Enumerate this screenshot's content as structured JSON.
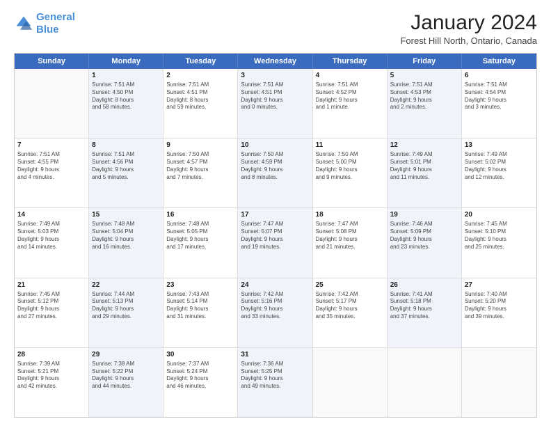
{
  "logo": {
    "line1": "General",
    "line2": "Blue"
  },
  "title": "January 2024",
  "subtitle": "Forest Hill North, Ontario, Canada",
  "header_days": [
    "Sunday",
    "Monday",
    "Tuesday",
    "Wednesday",
    "Thursday",
    "Friday",
    "Saturday"
  ],
  "weeks": [
    [
      {
        "day": "",
        "info": [],
        "shaded": false,
        "empty": true
      },
      {
        "day": "1",
        "info": [
          "Sunrise: 7:51 AM",
          "Sunset: 4:50 PM",
          "Daylight: 8 hours",
          "and 58 minutes."
        ],
        "shaded": true
      },
      {
        "day": "2",
        "info": [
          "Sunrise: 7:51 AM",
          "Sunset: 4:51 PM",
          "Daylight: 8 hours",
          "and 59 minutes."
        ],
        "shaded": false
      },
      {
        "day": "3",
        "info": [
          "Sunrise: 7:51 AM",
          "Sunset: 4:51 PM",
          "Daylight: 9 hours",
          "and 0 minutes."
        ],
        "shaded": true
      },
      {
        "day": "4",
        "info": [
          "Sunrise: 7:51 AM",
          "Sunset: 4:52 PM",
          "Daylight: 9 hours",
          "and 1 minute."
        ],
        "shaded": false
      },
      {
        "day": "5",
        "info": [
          "Sunrise: 7:51 AM",
          "Sunset: 4:53 PM",
          "Daylight: 9 hours",
          "and 2 minutes."
        ],
        "shaded": true
      },
      {
        "day": "6",
        "info": [
          "Sunrise: 7:51 AM",
          "Sunset: 4:54 PM",
          "Daylight: 9 hours",
          "and 3 minutes."
        ],
        "shaded": false
      }
    ],
    [
      {
        "day": "7",
        "info": [
          "Sunrise: 7:51 AM",
          "Sunset: 4:55 PM",
          "Daylight: 9 hours",
          "and 4 minutes."
        ],
        "shaded": false,
        "empty": false
      },
      {
        "day": "8",
        "info": [
          "Sunrise: 7:51 AM",
          "Sunset: 4:56 PM",
          "Daylight: 9 hours",
          "and 5 minutes."
        ],
        "shaded": true
      },
      {
        "day": "9",
        "info": [
          "Sunrise: 7:50 AM",
          "Sunset: 4:57 PM",
          "Daylight: 9 hours",
          "and 7 minutes."
        ],
        "shaded": false
      },
      {
        "day": "10",
        "info": [
          "Sunrise: 7:50 AM",
          "Sunset: 4:59 PM",
          "Daylight: 9 hours",
          "and 8 minutes."
        ],
        "shaded": true
      },
      {
        "day": "11",
        "info": [
          "Sunrise: 7:50 AM",
          "Sunset: 5:00 PM",
          "Daylight: 9 hours",
          "and 9 minutes."
        ],
        "shaded": false
      },
      {
        "day": "12",
        "info": [
          "Sunrise: 7:49 AM",
          "Sunset: 5:01 PM",
          "Daylight: 9 hours",
          "and 11 minutes."
        ],
        "shaded": true
      },
      {
        "day": "13",
        "info": [
          "Sunrise: 7:49 AM",
          "Sunset: 5:02 PM",
          "Daylight: 9 hours",
          "and 12 minutes."
        ],
        "shaded": false
      }
    ],
    [
      {
        "day": "14",
        "info": [
          "Sunrise: 7:49 AM",
          "Sunset: 5:03 PM",
          "Daylight: 9 hours",
          "and 14 minutes."
        ],
        "shaded": false,
        "empty": false
      },
      {
        "day": "15",
        "info": [
          "Sunrise: 7:48 AM",
          "Sunset: 5:04 PM",
          "Daylight: 9 hours",
          "and 16 minutes."
        ],
        "shaded": true
      },
      {
        "day": "16",
        "info": [
          "Sunrise: 7:48 AM",
          "Sunset: 5:05 PM",
          "Daylight: 9 hours",
          "and 17 minutes."
        ],
        "shaded": false
      },
      {
        "day": "17",
        "info": [
          "Sunrise: 7:47 AM",
          "Sunset: 5:07 PM",
          "Daylight: 9 hours",
          "and 19 minutes."
        ],
        "shaded": true
      },
      {
        "day": "18",
        "info": [
          "Sunrise: 7:47 AM",
          "Sunset: 5:08 PM",
          "Daylight: 9 hours",
          "and 21 minutes."
        ],
        "shaded": false
      },
      {
        "day": "19",
        "info": [
          "Sunrise: 7:46 AM",
          "Sunset: 5:09 PM",
          "Daylight: 9 hours",
          "and 23 minutes."
        ],
        "shaded": true
      },
      {
        "day": "20",
        "info": [
          "Sunrise: 7:45 AM",
          "Sunset: 5:10 PM",
          "Daylight: 9 hours",
          "and 25 minutes."
        ],
        "shaded": false
      }
    ],
    [
      {
        "day": "21",
        "info": [
          "Sunrise: 7:45 AM",
          "Sunset: 5:12 PM",
          "Daylight: 9 hours",
          "and 27 minutes."
        ],
        "shaded": false,
        "empty": false
      },
      {
        "day": "22",
        "info": [
          "Sunrise: 7:44 AM",
          "Sunset: 5:13 PM",
          "Daylight: 9 hours",
          "and 29 minutes."
        ],
        "shaded": true
      },
      {
        "day": "23",
        "info": [
          "Sunrise: 7:43 AM",
          "Sunset: 5:14 PM",
          "Daylight: 9 hours",
          "and 31 minutes."
        ],
        "shaded": false
      },
      {
        "day": "24",
        "info": [
          "Sunrise: 7:42 AM",
          "Sunset: 5:16 PM",
          "Daylight: 9 hours",
          "and 33 minutes."
        ],
        "shaded": true
      },
      {
        "day": "25",
        "info": [
          "Sunrise: 7:42 AM",
          "Sunset: 5:17 PM",
          "Daylight: 9 hours",
          "and 35 minutes."
        ],
        "shaded": false
      },
      {
        "day": "26",
        "info": [
          "Sunrise: 7:41 AM",
          "Sunset: 5:18 PM",
          "Daylight: 9 hours",
          "and 37 minutes."
        ],
        "shaded": true
      },
      {
        "day": "27",
        "info": [
          "Sunrise: 7:40 AM",
          "Sunset: 5:20 PM",
          "Daylight: 9 hours",
          "and 39 minutes."
        ],
        "shaded": false
      }
    ],
    [
      {
        "day": "28",
        "info": [
          "Sunrise: 7:39 AM",
          "Sunset: 5:21 PM",
          "Daylight: 9 hours",
          "and 42 minutes."
        ],
        "shaded": false,
        "empty": false
      },
      {
        "day": "29",
        "info": [
          "Sunrise: 7:38 AM",
          "Sunset: 5:22 PM",
          "Daylight: 9 hours",
          "and 44 minutes."
        ],
        "shaded": true
      },
      {
        "day": "30",
        "info": [
          "Sunrise: 7:37 AM",
          "Sunset: 5:24 PM",
          "Daylight: 9 hours",
          "and 46 minutes."
        ],
        "shaded": false
      },
      {
        "day": "31",
        "info": [
          "Sunrise: 7:36 AM",
          "Sunset: 5:25 PM",
          "Daylight: 9 hours",
          "and 49 minutes."
        ],
        "shaded": true
      },
      {
        "day": "",
        "info": [],
        "shaded": false,
        "empty": true
      },
      {
        "day": "",
        "info": [],
        "shaded": false,
        "empty": true
      },
      {
        "day": "",
        "info": [],
        "shaded": false,
        "empty": true
      }
    ]
  ]
}
